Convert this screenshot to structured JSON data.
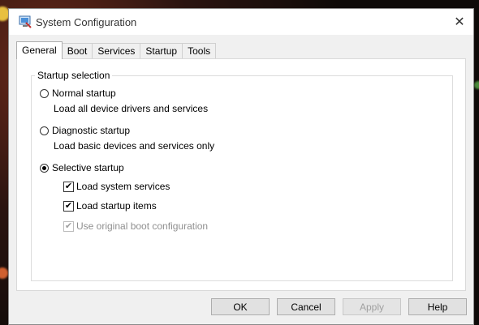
{
  "window": {
    "title": "System Configuration",
    "close_glyph": "✕"
  },
  "tabs": [
    {
      "label": "General",
      "active": true
    },
    {
      "label": "Boot",
      "active": false
    },
    {
      "label": "Services",
      "active": false
    },
    {
      "label": "Startup",
      "active": false
    },
    {
      "label": "Tools",
      "active": false
    }
  ],
  "startup_selection": {
    "legend": "Startup selection",
    "normal": {
      "label": "Normal startup",
      "description": "Load all device drivers and services",
      "selected": false
    },
    "diagnostic": {
      "label": "Diagnostic startup",
      "description": "Load basic devices and services only",
      "selected": false
    },
    "selective": {
      "label": "Selective startup",
      "selected": true,
      "options": [
        {
          "label": "Load system services",
          "checked": true,
          "enabled": true
        },
        {
          "label": "Load startup items",
          "checked": true,
          "enabled": true
        },
        {
          "label": "Use original boot configuration",
          "checked": true,
          "enabled": false
        }
      ]
    }
  },
  "buttons": {
    "ok": "OK",
    "cancel": "Cancel",
    "apply": "Apply",
    "help": "Help"
  },
  "icons": {
    "app": "msconfig-icon",
    "check": "✔"
  }
}
